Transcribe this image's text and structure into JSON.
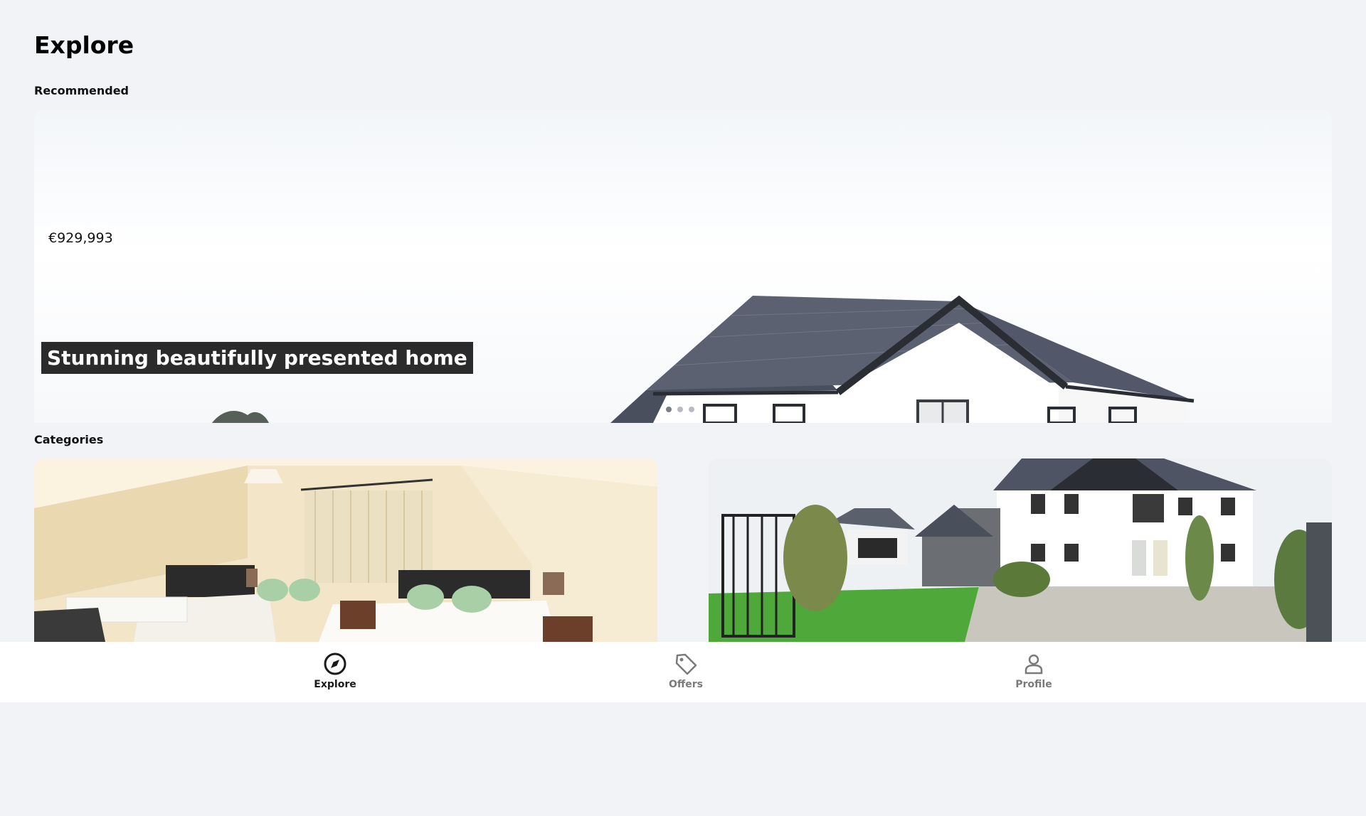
{
  "page": {
    "title": "Explore"
  },
  "sections": {
    "recommended": "Recommended",
    "categories": "Categories"
  },
  "featured": {
    "price": "€929,993",
    "title": "Stunning beautifully presented home",
    "slide_count": 3,
    "active_slide": 1
  },
  "categories": [
    {
      "image": "bedroom-photo"
    },
    {
      "image": "house-exterior-photo"
    }
  ],
  "nav": {
    "items": [
      {
        "label": "Explore",
        "icon": "compass-icon",
        "active": true
      },
      {
        "label": "Offers",
        "icon": "tag-icon",
        "active": false
      },
      {
        "label": "Profile",
        "icon": "person-icon",
        "active": false
      }
    ]
  },
  "colors": {
    "background": "#f2f3f6",
    "active_nav": "#1a1a1a",
    "inactive_nav": "#7a7a7a",
    "title_badge": "#2b2b2b"
  }
}
